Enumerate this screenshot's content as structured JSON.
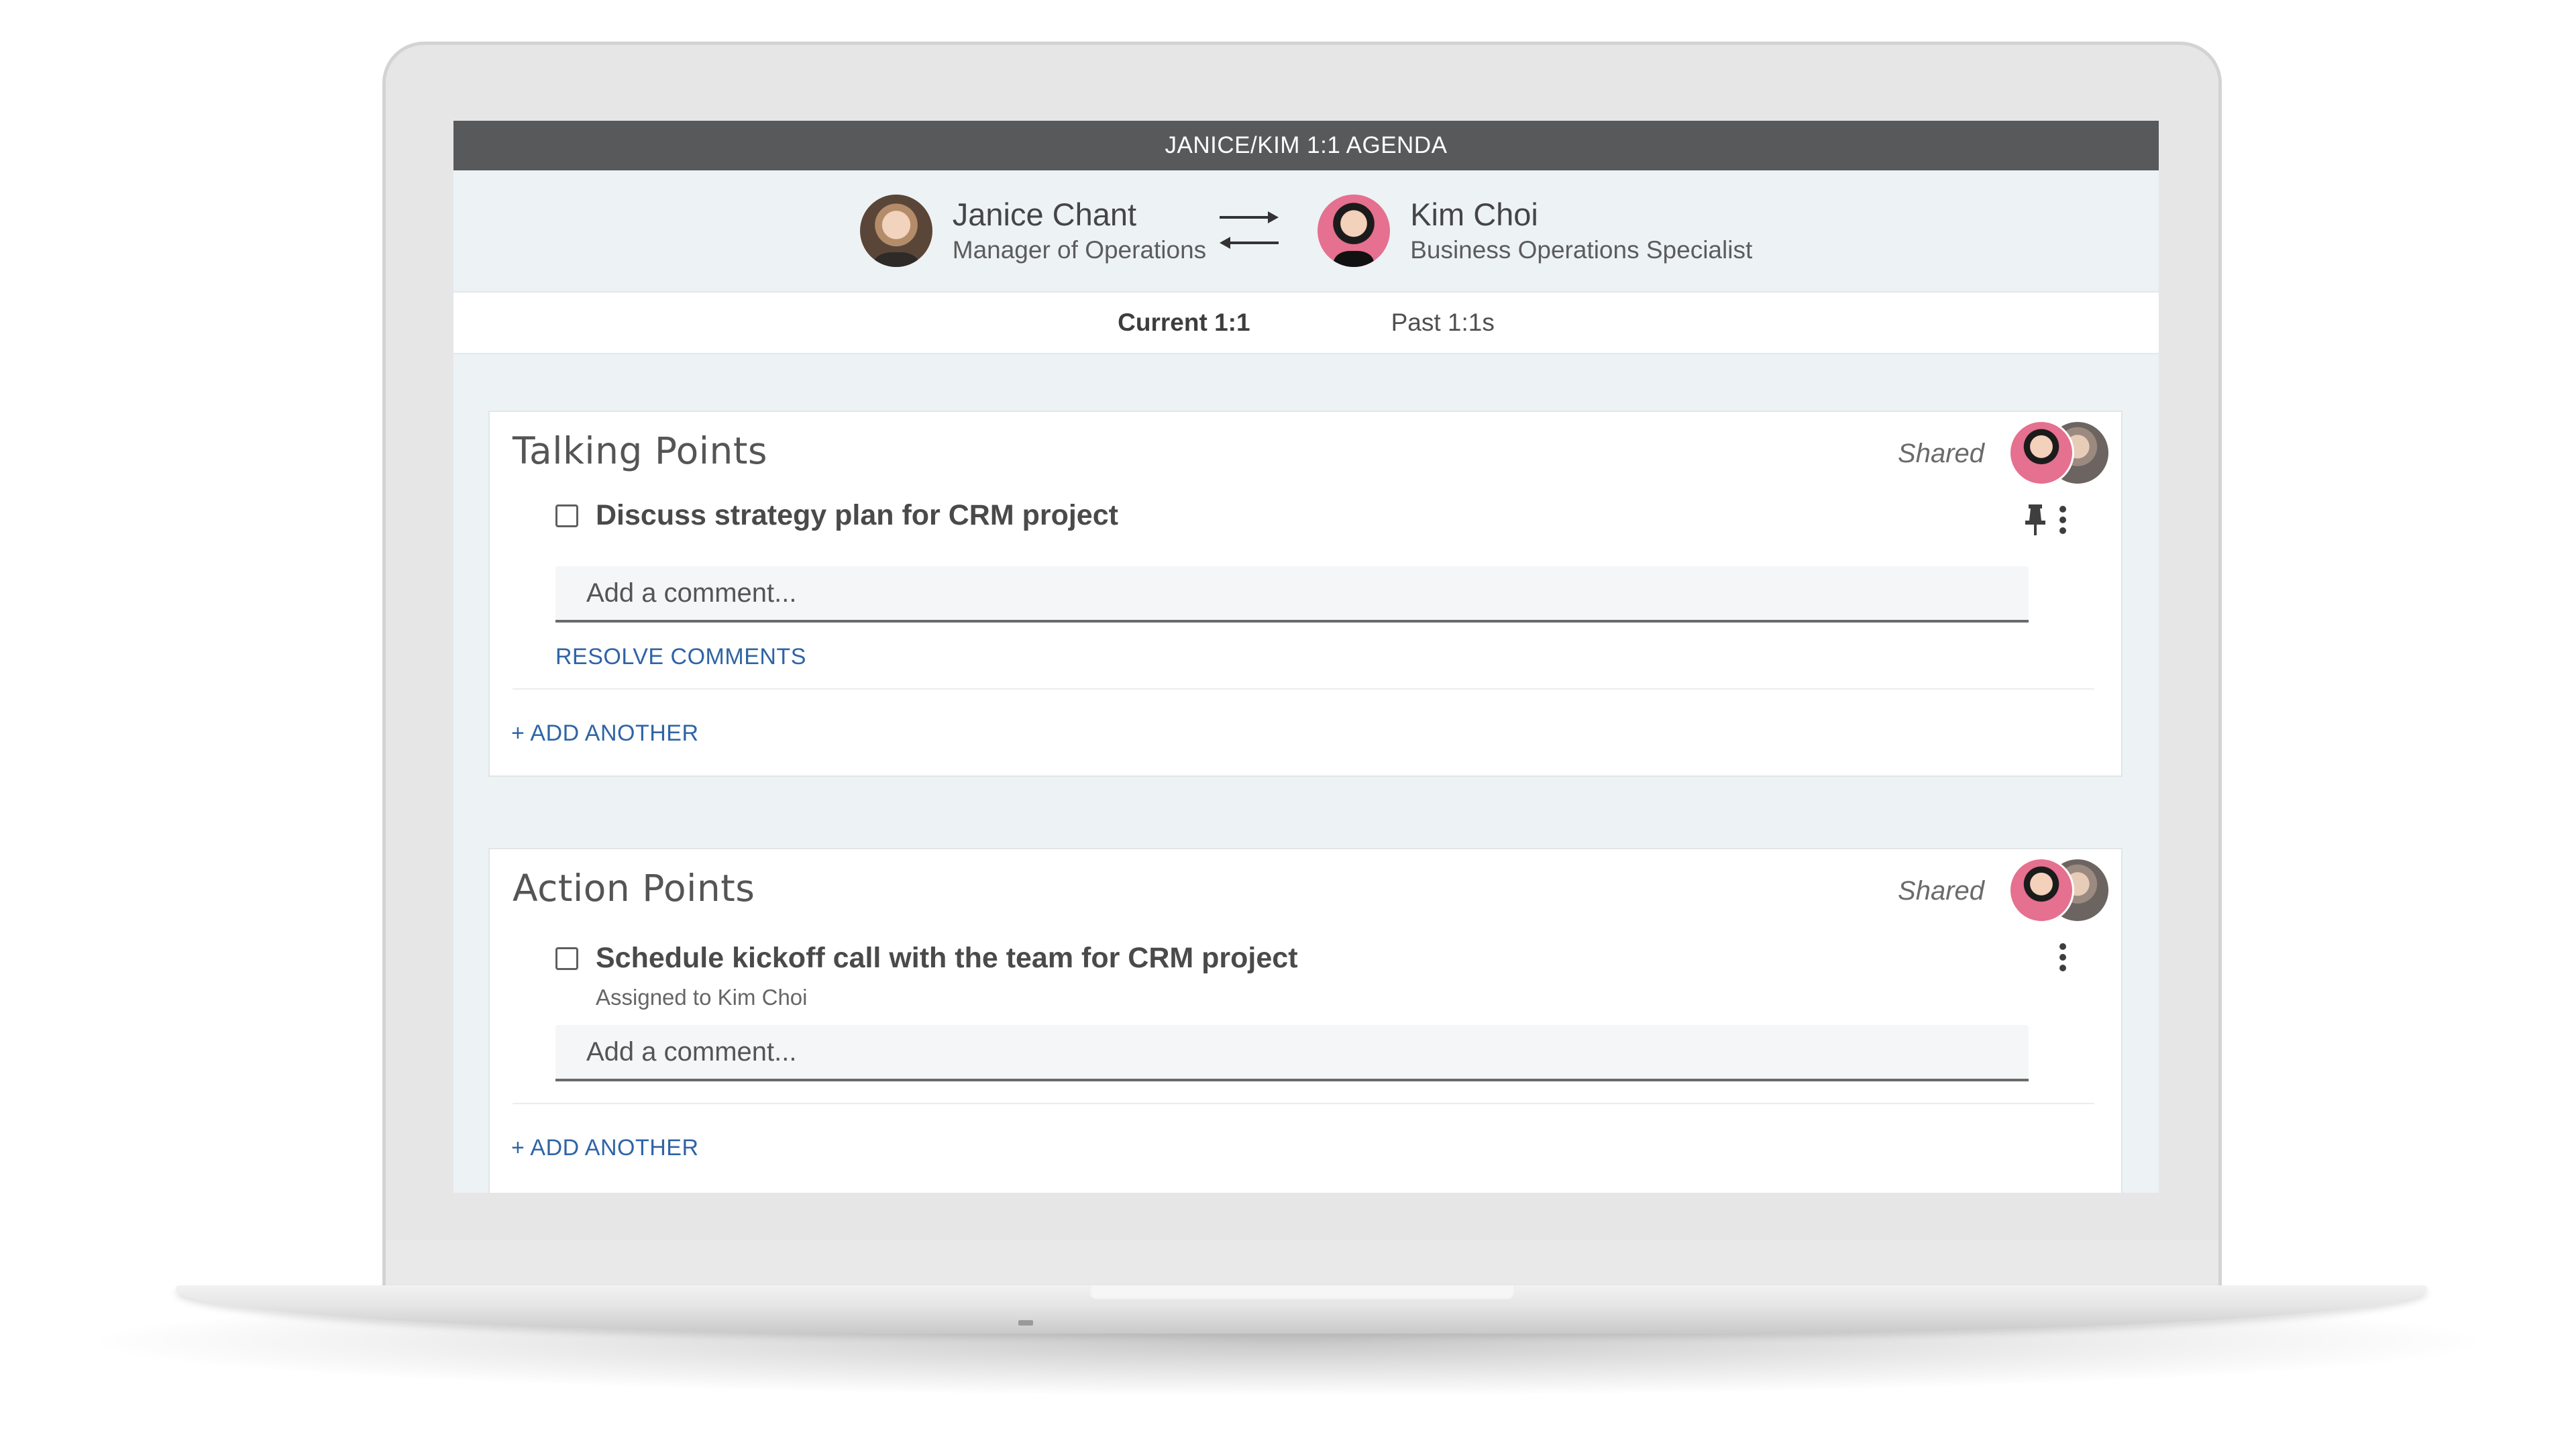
{
  "app": {
    "title": "JANICE/KIM 1:1 AGENDA"
  },
  "participants": {
    "manager": {
      "name": "Janice Chant",
      "role": "Manager of Operations"
    },
    "report": {
      "name": "Kim Choi",
      "role": "Business Operations Specialist"
    },
    "swap_icon": "swap-arrows-icon"
  },
  "tabs": [
    {
      "label": "Current 1:1",
      "active": true
    },
    {
      "label": "Past 1:1s",
      "active": false
    }
  ],
  "talking_points": {
    "title": "Talking Points",
    "visibility": "Shared",
    "items": [
      {
        "text": "Discuss strategy plan for CRM project",
        "checked": false,
        "pinned": true
      }
    ],
    "comment_placeholder": "Add a comment...",
    "resolve_label": "RESOLVE COMMENTS",
    "add_label": "+ ADD ANOTHER"
  },
  "action_points": {
    "title": "Action Points",
    "visibility": "Shared",
    "items": [
      {
        "text": "Schedule kickoff call with the team for CRM project",
        "checked": false,
        "assigned": "Assigned to Kim Choi"
      }
    ],
    "comment_placeholder": "Add a comment...",
    "add_label": "+ ADD ANOTHER"
  },
  "colors": {
    "titlebar": "#58595b",
    "page_bg": "#edf2f5",
    "link": "#2f64a6"
  }
}
